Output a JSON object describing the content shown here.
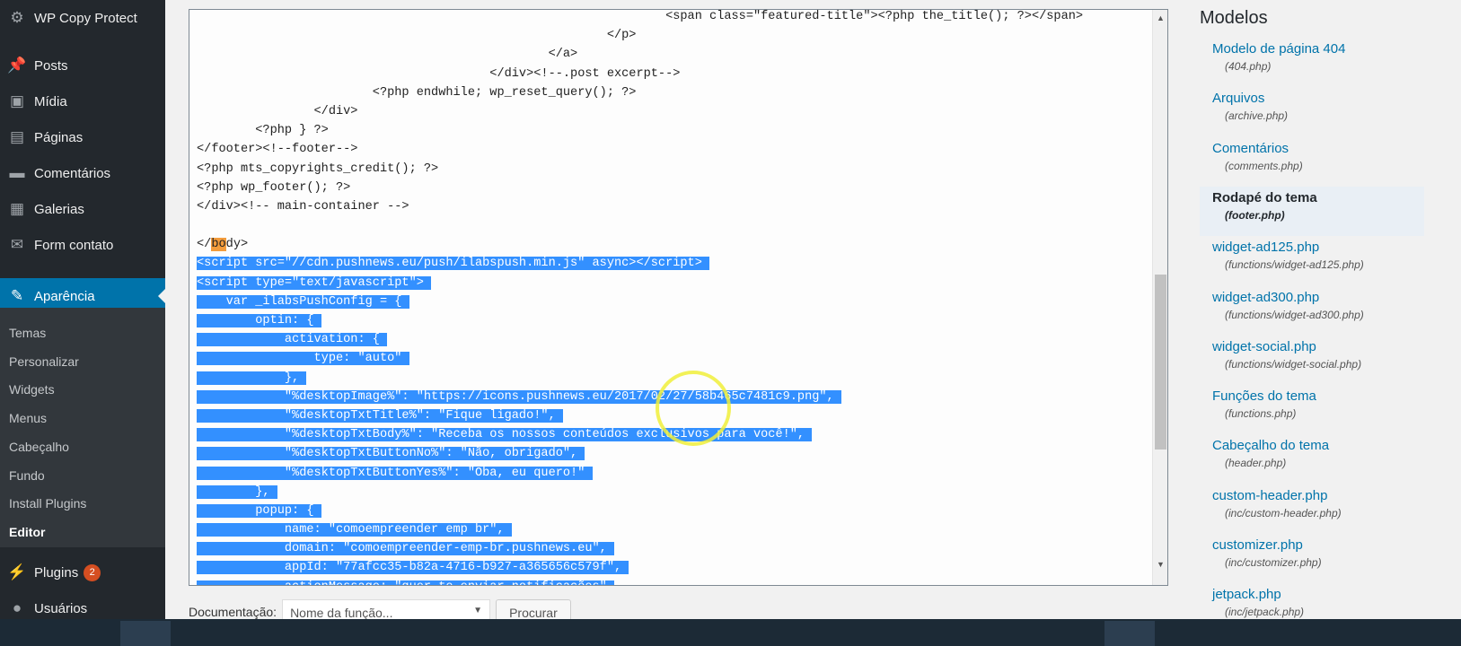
{
  "sidebar": {
    "items": [
      {
        "label": "WP Copy Protect",
        "icon": "gear-icon"
      },
      {
        "label": "Posts",
        "icon": "pin-icon"
      },
      {
        "label": "Mídia",
        "icon": "media-icon"
      },
      {
        "label": "Páginas",
        "icon": "page-icon"
      },
      {
        "label": "Comentários",
        "icon": "comment-icon"
      },
      {
        "label": "Galerias",
        "icon": "gallery-icon"
      },
      {
        "label": "Form contato",
        "icon": "mail-icon"
      },
      {
        "label": "Aparência",
        "icon": "brush-icon"
      },
      {
        "label": "Plugins",
        "icon": "plug-icon",
        "badge": "2"
      },
      {
        "label": "Usuários",
        "icon": "user-icon"
      }
    ],
    "submenu": [
      "Temas",
      "Personalizar",
      "Widgets",
      "Menus",
      "Cabeçalho",
      "Fundo",
      "Install Plugins",
      "Editor"
    ]
  },
  "editor": {
    "lines": [
      {
        "t": "                                                                <span class=\"featured-title\"><?php the_title(); ?></span>",
        "s": false
      },
      {
        "t": "                                                        </p>",
        "s": false
      },
      {
        "t": "                                                </a>",
        "s": false
      },
      {
        "t": "                                        </div><!--.post excerpt-->",
        "s": false
      },
      {
        "t": "                        <?php endwhile; wp_reset_query(); ?>",
        "s": false
      },
      {
        "t": "                </div>",
        "s": false
      },
      {
        "t": "        <?php } ?>",
        "s": false
      },
      {
        "t": "</footer><!--footer-->",
        "s": false
      },
      {
        "t": "<?php mts_copyrights_credit(); ?>",
        "s": false
      },
      {
        "t": "<?php wp_footer(); ?>",
        "s": false
      },
      {
        "t": "</div><!-- main-container -->",
        "s": false
      },
      {
        "t": "",
        "s": false
      },
      {
        "t": "</body>",
        "s": false
      },
      {
        "t": "<script src=\"//cdn.pushnews.eu/push/ilabspush.min.js\" async></script>",
        "s": true
      },
      {
        "t": "<script type=\"text/javascript\">",
        "s": true
      },
      {
        "t": "    var _ilabsPushConfig = {",
        "s": true
      },
      {
        "t": "        optin: {",
        "s": true
      },
      {
        "t": "            activation: {",
        "s": true
      },
      {
        "t": "                type: \"auto\"",
        "s": true
      },
      {
        "t": "            },",
        "s": true
      },
      {
        "t": "            \"%desktopImage%\": \"https://icons.pushnews.eu/2017/02/27/58b465c7481c9.png\",",
        "s": true
      },
      {
        "t": "            \"%desktopTxtTitle%\": \"Fique ligado!\",",
        "s": true
      },
      {
        "t": "            \"%desktopTxtBody%\": \"Receba os nossos conteúdos exclusivos para você!\",",
        "s": true
      },
      {
        "t": "            \"%desktopTxtButtonNo%\": \"Não, obrigado\",",
        "s": true
      },
      {
        "t": "            \"%desktopTxtButtonYes%\": \"Oba, eu quero!\"",
        "s": true
      },
      {
        "t": "        },",
        "s": true
      },
      {
        "t": "        popup: {",
        "s": true
      },
      {
        "t": "            name: \"comoempreender emp br\",",
        "s": true
      },
      {
        "t": "            domain: \"comoempreender-emp-br.pushnews.eu\",",
        "s": true
      },
      {
        "t": "            appId: \"77afcc35-b82a-4716-b927-a365656c579f\",",
        "s": true
      },
      {
        "t": "            actionMessage: \"quer te enviar notificações\"",
        "s": true
      }
    ]
  },
  "templates": {
    "title": "Modelos",
    "items": [
      {
        "name": "Modelo de página 404",
        "file": "(404.php)"
      },
      {
        "name": "Arquivos",
        "file": "(archive.php)"
      },
      {
        "name": "Comentários",
        "file": "(comments.php)"
      },
      {
        "name": "Rodapé do tema",
        "file": "(footer.php)",
        "current": true
      },
      {
        "name": "widget-ad125.php",
        "file": "(functions/widget-ad125.php)"
      },
      {
        "name": "widget-ad300.php",
        "file": "(functions/widget-ad300.php)"
      },
      {
        "name": "widget-social.php",
        "file": "(functions/widget-social.php)"
      },
      {
        "name": "Funções do tema",
        "file": "(functions.php)"
      },
      {
        "name": "Cabeçalho do tema",
        "file": "(header.php)"
      },
      {
        "name": "custom-header.php",
        "file": "(inc/custom-header.php)"
      },
      {
        "name": "customizer.php",
        "file": "(inc/customizer.php)"
      },
      {
        "name": "jetpack.php",
        "file": "(inc/jetpack.php)"
      }
    ]
  },
  "docs": {
    "label": "Documentação:",
    "placeholder": "Nome da função...",
    "button": "Procurar"
  },
  "colors": {
    "accent": "#0073aa",
    "selection": "#3390ff",
    "sidebar": "#23282d"
  }
}
